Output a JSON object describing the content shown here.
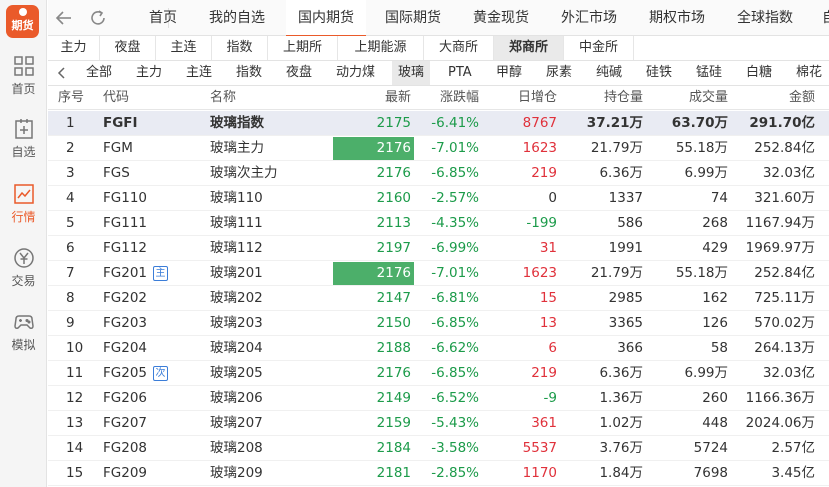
{
  "app": {
    "logo_text": "期货",
    "accent": "#ea5a2a"
  },
  "sidebar": {
    "items": [
      {
        "label": "首页",
        "icon": "grid-icon"
      },
      {
        "label": "自选",
        "icon": "plus-square-icon"
      },
      {
        "label": "行情",
        "icon": "chart-icon",
        "active": true
      },
      {
        "label": "交易",
        "icon": "yen-icon"
      },
      {
        "label": "模拟",
        "icon": "gamepad-icon"
      }
    ]
  },
  "topnav": {
    "back_icon": "back-arrow-icon",
    "refresh_icon": "refresh-icon",
    "tabs": [
      {
        "label": "首页"
      },
      {
        "label": "我的自选"
      },
      {
        "label": "国内期货",
        "active": true
      },
      {
        "label": "国际期货"
      },
      {
        "label": "黄金现货"
      },
      {
        "label": "外汇市场"
      },
      {
        "label": "期权市场"
      },
      {
        "label": "全球指数"
      },
      {
        "label": "自"
      }
    ]
  },
  "markets": [
    {
      "label": "主力"
    },
    {
      "label": "夜盘"
    },
    {
      "label": "主连"
    },
    {
      "label": "指数"
    },
    {
      "label": "上期所"
    },
    {
      "label": "上期能源"
    },
    {
      "label": "大商所"
    },
    {
      "label": "郑商所",
      "active": true
    },
    {
      "label": "中金所"
    }
  ],
  "products": [
    {
      "label": "全部"
    },
    {
      "label": "主力"
    },
    {
      "label": "主连"
    },
    {
      "label": "指数"
    },
    {
      "label": "夜盘"
    },
    {
      "label": "动力煤"
    },
    {
      "label": "玻璃",
      "active": true
    },
    {
      "label": "PTA"
    },
    {
      "label": "甲醇"
    },
    {
      "label": "尿素"
    },
    {
      "label": "纯碱"
    },
    {
      "label": "硅铁"
    },
    {
      "label": "锰硅"
    },
    {
      "label": "白糖"
    },
    {
      "label": "棉花"
    }
  ],
  "table": {
    "headers": {
      "index": "序号",
      "code": "代码",
      "name": "名称",
      "last": "最新",
      "change": "涨跌幅",
      "daily_oi": "日增仓",
      "oi": "持仓量",
      "volume": "成交量",
      "amount": "金额"
    },
    "rows": [
      {
        "index": "1",
        "code": "FGFI",
        "name": "玻璃指数",
        "last": "2175",
        "change": "-6.41%",
        "daily_oi": "8767",
        "oi": "37.21万",
        "volume": "63.70万",
        "amount": "291.70亿",
        "highlight": true,
        "bold": true
      },
      {
        "index": "2",
        "code": "FGM",
        "name": "玻璃主力",
        "last": "2176",
        "change": "-7.01%",
        "daily_oi": "1623",
        "oi": "21.79万",
        "volume": "55.18万",
        "amount": "252.84亿",
        "box": true
      },
      {
        "index": "3",
        "code": "FGS",
        "name": "玻璃次主力",
        "last": "2176",
        "change": "-6.85%",
        "daily_oi": "219",
        "oi": "6.36万",
        "volume": "6.99万",
        "amount": "32.03亿"
      },
      {
        "index": "4",
        "code": "FG110",
        "name": "玻璃110",
        "last": "2160",
        "change": "-2.57%",
        "daily_oi": "0",
        "oi": "1337",
        "volume": "74",
        "amount": "321.60万"
      },
      {
        "index": "5",
        "code": "FG111",
        "name": "玻璃111",
        "last": "2113",
        "change": "-4.35%",
        "daily_oi": "-199",
        "oi": "586",
        "volume": "268",
        "amount": "1167.94万"
      },
      {
        "index": "6",
        "code": "FG112",
        "name": "玻璃112",
        "last": "2197",
        "change": "-6.99%",
        "daily_oi": "31",
        "oi": "1991",
        "volume": "429",
        "amount": "1969.97万"
      },
      {
        "index": "7",
        "code": "FG201",
        "name": "玻璃201",
        "last": "2176",
        "change": "-7.01%",
        "daily_oi": "1623",
        "oi": "21.79万",
        "volume": "55.18万",
        "amount": "252.84亿",
        "box": true,
        "tag": "主"
      },
      {
        "index": "8",
        "code": "FG202",
        "name": "玻璃202",
        "last": "2147",
        "change": "-6.81%",
        "daily_oi": "15",
        "oi": "2985",
        "volume": "162",
        "amount": "725.11万"
      },
      {
        "index": "9",
        "code": "FG203",
        "name": "玻璃203",
        "last": "2150",
        "change": "-6.85%",
        "daily_oi": "13",
        "oi": "3365",
        "volume": "126",
        "amount": "570.02万"
      },
      {
        "index": "10",
        "code": "FG204",
        "name": "玻璃204",
        "last": "2188",
        "change": "-6.62%",
        "daily_oi": "6",
        "oi": "366",
        "volume": "58",
        "amount": "264.13万"
      },
      {
        "index": "11",
        "code": "FG205",
        "name": "玻璃205",
        "last": "2176",
        "change": "-6.85%",
        "daily_oi": "219",
        "oi": "6.36万",
        "volume": "6.99万",
        "amount": "32.03亿",
        "tag": "次"
      },
      {
        "index": "12",
        "code": "FG206",
        "name": "玻璃206",
        "last": "2149",
        "change": "-6.52%",
        "daily_oi": "-9",
        "oi": "1.36万",
        "volume": "260",
        "amount": "1166.36万"
      },
      {
        "index": "13",
        "code": "FG207",
        "name": "玻璃207",
        "last": "2159",
        "change": "-5.43%",
        "daily_oi": "361",
        "oi": "1.02万",
        "volume": "448",
        "amount": "2024.06万"
      },
      {
        "index": "14",
        "code": "FG208",
        "name": "玻璃208",
        "last": "2184",
        "change": "-3.58%",
        "daily_oi": "5537",
        "oi": "3.76万",
        "volume": "5724",
        "amount": "2.57亿"
      },
      {
        "index": "15",
        "code": "FG209",
        "name": "玻璃209",
        "last": "2181",
        "change": "-2.85%",
        "daily_oi": "1170",
        "oi": "1.84万",
        "volume": "7698",
        "amount": "3.45亿"
      }
    ]
  }
}
